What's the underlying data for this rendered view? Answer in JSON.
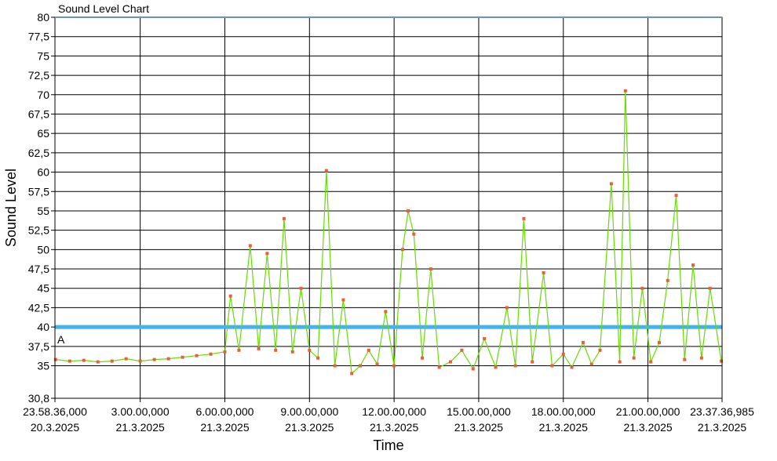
{
  "chart_data": {
    "type": "line",
    "title": "Sound Level Chart",
    "xlabel": "Time",
    "ylabel": "Sound Level",
    "ylim": [
      30.8,
      80
    ],
    "grid": true,
    "y_ticks": [
      "80",
      "77,5",
      "75",
      "72,5",
      "70",
      "67,5",
      "65",
      "62,5",
      "60",
      "57,5",
      "55",
      "52,5",
      "50",
      "47,5",
      "45",
      "42,5",
      "40",
      "37,5",
      "35",
      "30,8"
    ],
    "y_tick_values": [
      80,
      77.5,
      75,
      72.5,
      70,
      67.5,
      65,
      62.5,
      60,
      57.5,
      55,
      52.5,
      50,
      47.5,
      45,
      42.5,
      40,
      37.5,
      35,
      30.8
    ],
    "x_ticks": [
      {
        "time": "23.58.36,000",
        "date": "20.3.2025"
      },
      {
        "time": "3.00.00,000",
        "date": "21.3.2025"
      },
      {
        "time": "6.00.00,000",
        "date": "21.3.2025"
      },
      {
        "time": "9.00.00,000",
        "date": "21.3.2025"
      },
      {
        "time": "12.00.00,000",
        "date": "21.3.2025"
      },
      {
        "time": "15.00.00,000",
        "date": "21.3.2025"
      },
      {
        "time": "18.00.00,000",
        "date": "21.3.2025"
      },
      {
        "time": "21.00.00,000",
        "date": "21.3.2025"
      },
      {
        "time": "23.37.36,985",
        "date": "21.3.2025"
      }
    ],
    "x_tick_hours": [
      -0.0233,
      3,
      6,
      9,
      12,
      15,
      18,
      21,
      23.6269
    ],
    "threshold": {
      "value": 40,
      "label": "A",
      "color": "#3fb4f0"
    },
    "series": [
      {
        "line_color": "#66dd00",
        "marker_color": "#e8603a",
        "points": [
          [
            0.0,
            35.8
          ],
          [
            0.5,
            35.6
          ],
          [
            1.0,
            35.7
          ],
          [
            1.5,
            35.5
          ],
          [
            2.0,
            35.6
          ],
          [
            2.5,
            35.9
          ],
          [
            3.0,
            35.6
          ],
          [
            3.5,
            35.8
          ],
          [
            4.0,
            35.9
          ],
          [
            4.5,
            36.1
          ],
          [
            5.0,
            36.3
          ],
          [
            5.5,
            36.5
          ],
          [
            6.0,
            36.8
          ],
          [
            6.2,
            44.0
          ],
          [
            6.5,
            37.0
          ],
          [
            6.9,
            50.5
          ],
          [
            7.2,
            37.2
          ],
          [
            7.5,
            49.5
          ],
          [
            7.8,
            37.0
          ],
          [
            8.1,
            54.0
          ],
          [
            8.4,
            36.8
          ],
          [
            8.7,
            45.0
          ],
          [
            9.0,
            37.0
          ],
          [
            9.3,
            36.0
          ],
          [
            9.6,
            60.2
          ],
          [
            9.9,
            35.0
          ],
          [
            10.2,
            43.5
          ],
          [
            10.5,
            34.0
          ],
          [
            10.8,
            35.0
          ],
          [
            11.1,
            37.0
          ],
          [
            11.4,
            35.2
          ],
          [
            11.7,
            42.0
          ],
          [
            12.0,
            35.0
          ],
          [
            12.3,
            50.0
          ],
          [
            12.5,
            55.0
          ],
          [
            12.7,
            52.0
          ],
          [
            13.0,
            36.0
          ],
          [
            13.3,
            47.5
          ],
          [
            13.6,
            34.8
          ],
          [
            14.0,
            35.5
          ],
          [
            14.4,
            37.0
          ],
          [
            14.8,
            34.6
          ],
          [
            15.2,
            38.5
          ],
          [
            15.6,
            34.8
          ],
          [
            16.0,
            42.5
          ],
          [
            16.3,
            35.0
          ],
          [
            16.6,
            54.0
          ],
          [
            16.9,
            35.5
          ],
          [
            17.3,
            47.0
          ],
          [
            17.6,
            35.0
          ],
          [
            18.0,
            36.5
          ],
          [
            18.3,
            34.8
          ],
          [
            18.7,
            38.0
          ],
          [
            19.0,
            35.2
          ],
          [
            19.3,
            37.0
          ],
          [
            19.7,
            58.5
          ],
          [
            20.0,
            35.5
          ],
          [
            20.2,
            70.5
          ],
          [
            20.5,
            36.0
          ],
          [
            20.8,
            45.0
          ],
          [
            21.1,
            35.5
          ],
          [
            21.4,
            38.0
          ],
          [
            21.7,
            46.0
          ],
          [
            22.0,
            57.0
          ],
          [
            22.3,
            35.8
          ],
          [
            22.6,
            48.0
          ],
          [
            22.9,
            36.0
          ],
          [
            23.2,
            45.0
          ],
          [
            23.6,
            35.6
          ]
        ]
      }
    ]
  }
}
